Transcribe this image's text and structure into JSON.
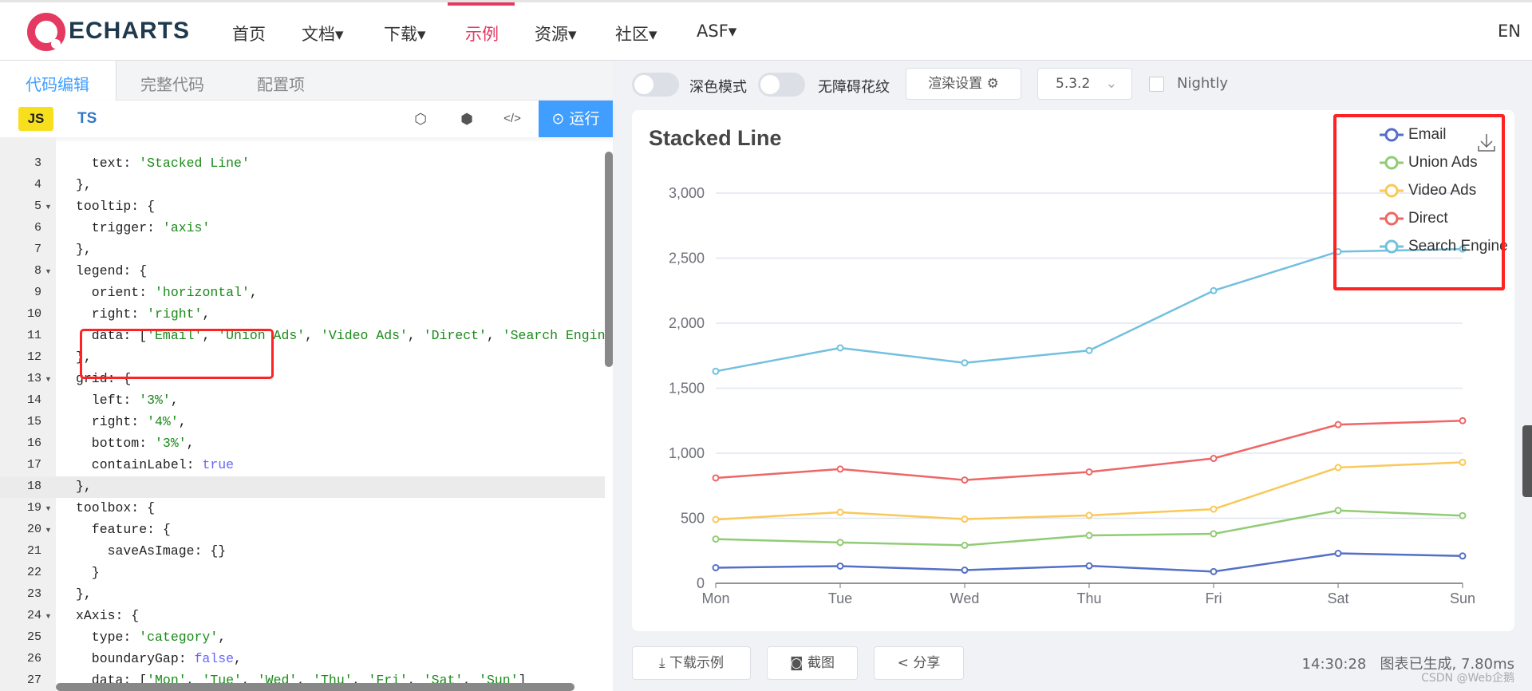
{
  "nav": {
    "logo": "ECHARTS",
    "items": [
      "首页",
      "文档▾",
      "下载▾",
      "示例",
      "资源▾",
      "社区▾",
      "ASF▾"
    ],
    "active_index": 3,
    "lang": "EN"
  },
  "editor": {
    "tabs": [
      "代码编辑",
      "完整代码",
      "配置项"
    ],
    "lang_js": "JS",
    "lang_ts": "TS",
    "run_label": "运行",
    "icons": [
      "codepen-icon",
      "codesandbox-icon",
      "embed-code-icon",
      "play-circle-icon"
    ],
    "current_line": 18,
    "lines": [
      {
        "n": 3,
        "t": "  text: 'Stacked Line'"
      },
      {
        "n": 4,
        "t": "},"
      },
      {
        "n": 5,
        "t": "tooltip: {",
        "fold": true
      },
      {
        "n": 6,
        "t": "  trigger: 'axis'"
      },
      {
        "n": 7,
        "t": "},"
      },
      {
        "n": 8,
        "t": "legend: {",
        "fold": true
      },
      {
        "n": 9,
        "t": "  orient: 'horizontal',"
      },
      {
        "n": 10,
        "t": "  right: 'right',"
      },
      {
        "n": 11,
        "t": "  data: ['Email', 'Union Ads', 'Video Ads', 'Direct', 'Search Engin"
      },
      {
        "n": 12,
        "t": "},"
      },
      {
        "n": 13,
        "t": "grid: {",
        "fold": true
      },
      {
        "n": 14,
        "t": "  left: '3%',"
      },
      {
        "n": 15,
        "t": "  right: '4%',"
      },
      {
        "n": 16,
        "t": "  bottom: '3%',"
      },
      {
        "n": 17,
        "t": "  containLabel: true"
      },
      {
        "n": 18,
        "t": "},"
      },
      {
        "n": 19,
        "t": "toolbox: {",
        "fold": true
      },
      {
        "n": 20,
        "t": "  feature: {",
        "fold": true
      },
      {
        "n": 21,
        "t": "    saveAsImage: {}"
      },
      {
        "n": 22,
        "t": "  }"
      },
      {
        "n": 23,
        "t": "},"
      },
      {
        "n": 24,
        "t": "xAxis: {",
        "fold": true
      },
      {
        "n": 25,
        "t": "  type: 'category',"
      },
      {
        "n": 26,
        "t": "  boundaryGap: false,"
      },
      {
        "n": 27,
        "t": "  data: ['Mon', 'Tue', 'Wed', 'Thu', 'Fri', 'Sat', 'Sun']"
      }
    ]
  },
  "controls": {
    "dark_mode": "深色模式",
    "dark_mode_on": false,
    "decal": "无障碍花纹",
    "decal_on": false,
    "render_settings": "渲染设置 ⚙",
    "version": "5.3.2",
    "nightly": "Nightly",
    "nightly_checked": false
  },
  "footer": {
    "download": "下载示例",
    "screenshot": "截图",
    "share": "分享",
    "status": "14:30:28   图表已生成, 7.80ms",
    "watermark": "CSDN @Web企鹅"
  },
  "chart_data": {
    "type": "line",
    "stacked": true,
    "title": "Stacked Line",
    "categories": [
      "Mon",
      "Tue",
      "Wed",
      "Thu",
      "Fri",
      "Sat",
      "Sun"
    ],
    "ylim": [
      0,
      3000
    ],
    "yticks": [
      "0",
      "500",
      "1,000",
      "1,500",
      "2,000",
      "2,500",
      "3,000"
    ],
    "grid": true,
    "legend_position": "top-right",
    "series": [
      {
        "name": "Email",
        "color": "#5470c6",
        "values": [
          120,
          132,
          101,
          134,
          90,
          230,
          210
        ]
      },
      {
        "name": "Union Ads",
        "color": "#91cc75",
        "values": [
          220,
          182,
          191,
          234,
          290,
          330,
          310
        ]
      },
      {
        "name": "Video Ads",
        "color": "#fac858",
        "values": [
          150,
          232,
          201,
          154,
          190,
          330,
          410
        ]
      },
      {
        "name": "Direct",
        "color": "#ee6666",
        "values": [
          320,
          332,
          301,
          334,
          390,
          330,
          320
        ]
      },
      {
        "name": "Search Engine",
        "color": "#73c0de",
        "values": [
          820,
          932,
          901,
          934,
          1290,
          1330,
          1320
        ]
      }
    ],
    "toolbox": "download-icon"
  }
}
